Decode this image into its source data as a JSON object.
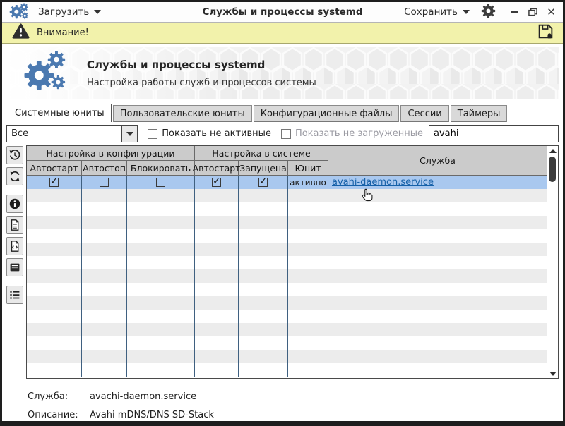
{
  "titlebar": {
    "load_label": "Загрузить",
    "title": "Службы и процессы systemd",
    "save_label": "Сохранить"
  },
  "warning": {
    "label": "Внимание!"
  },
  "banner": {
    "title": "Службы и процессы systemd",
    "subtitle": "Настройка работы служб и процессов системы"
  },
  "tabs": [
    {
      "label": "Системные юниты",
      "active": true
    },
    {
      "label": "Пользовательские юниты",
      "active": false
    },
    {
      "label": "Конфигурационные файлы",
      "active": false
    },
    {
      "label": "Сессии",
      "active": false
    },
    {
      "label": "Таймеры",
      "active": false
    }
  ],
  "filters": {
    "unit_filter_value": "Все",
    "show_inactive": {
      "label": "Показать не активные",
      "checked": false
    },
    "show_unloaded": {
      "label": "Показать не загруженные",
      "checked": false
    },
    "search_value": "avahi"
  },
  "toolbar": {
    "buttons": [
      "history-icon",
      "refresh-icon",
      "info-icon",
      "document-icon",
      "source-file-icon",
      "journal-icon",
      "unit-list-icon"
    ]
  },
  "table": {
    "group_headers": {
      "config": "Настройка в конфигурации",
      "system": "Настройка в системе",
      "service": "Служба"
    },
    "columns": [
      "Автостарт",
      "Автостоп",
      "Блокировать",
      "Автостарт",
      "Запущена",
      "Юнит"
    ],
    "selected_row": {
      "config_autostart": true,
      "config_autostop": false,
      "config_block": false,
      "system_autostart": true,
      "system_running": true,
      "unit_state": "активно",
      "service_link": "avahi-daemon.service"
    },
    "empty_row_count": 14
  },
  "status": {
    "service_label": "Служба:",
    "service_value": "avachi-daemon.service",
    "description_label": "Описание:",
    "description_value": "Avahi mDNS/DNS SD-Stack"
  },
  "colors": {
    "accent_blue": "#4b79b0",
    "warning_bg": "#f2f2ab",
    "selected_row_bg": "#a9c8ef",
    "link": "#1560a8",
    "header_bg": "#cbcbcb"
  }
}
